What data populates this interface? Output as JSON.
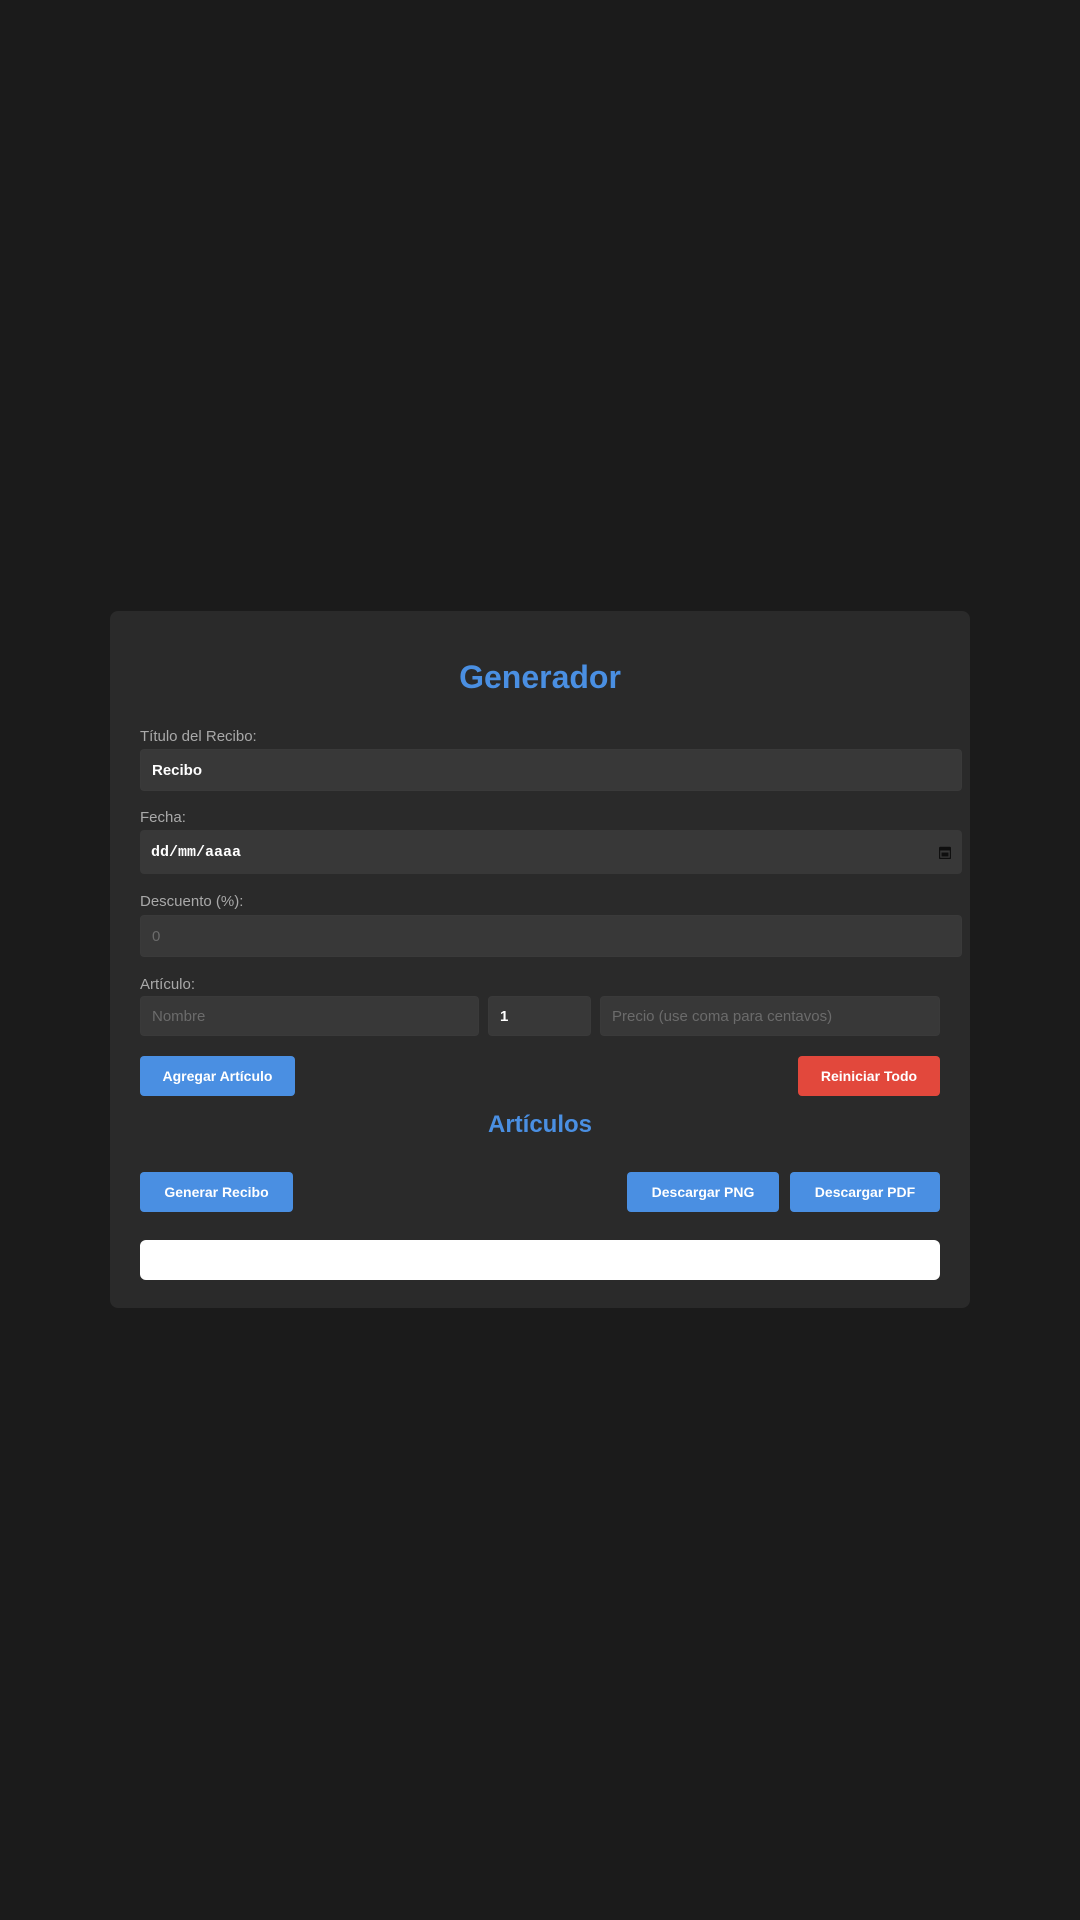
{
  "app": {
    "title": "Generador"
  },
  "form": {
    "receipt_title_label": "Título del Recibo:",
    "receipt_title_value": "Recibo",
    "date_label": "Fecha:",
    "date_value": "dd/mm/aaaa",
    "discount_label": "Descuento (%):",
    "discount_placeholder": "0",
    "item_label": "Artículo:",
    "item_name_placeholder": "Nombre",
    "item_quantity_value": "1",
    "item_price_placeholder": "Precio (use coma para centavos)"
  },
  "actions": {
    "add_item": "Agregar Artículo",
    "reset_all": "Reiniciar Todo",
    "generate_receipt": "Generar Recibo",
    "download_png": "Descargar PNG",
    "download_pdf": "Descargar PDF"
  },
  "items_section": {
    "heading": "Artículos"
  },
  "icons": {
    "date": "calendar-icon"
  },
  "colors": {
    "page_background": "#1b1b1b",
    "card_background": "#2a2a2a",
    "input_background": "#383838",
    "accent_blue": "#4a8fe2",
    "danger_red": "#e2483c",
    "label_gray": "#a9a9a9",
    "output_white": "#ffffff"
  }
}
